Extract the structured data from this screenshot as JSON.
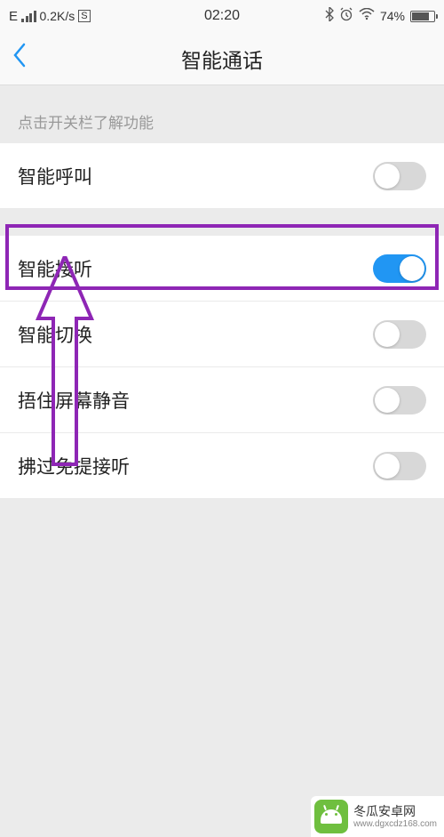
{
  "status_bar": {
    "net_type": "E",
    "speed": "0.2K/s",
    "indicator": "S",
    "time": "02:20",
    "battery_pct": "74%"
  },
  "header": {
    "title": "智能通话"
  },
  "section_hint": "点击开关栏了解功能",
  "settings": {
    "smart_call": {
      "label": "智能呼叫",
      "on": false
    },
    "smart_answer": {
      "label": "智能接听",
      "on": true
    },
    "smart_switch": {
      "label": "智能切换",
      "on": false
    },
    "cover_mute": {
      "label": "捂住屏幕静音",
      "on": false
    },
    "wave_speaker": {
      "label": "拂过免提接听",
      "on": false
    }
  },
  "watermark": {
    "name": "冬瓜安卓网",
    "url": "www.dgxcdz168.com"
  }
}
